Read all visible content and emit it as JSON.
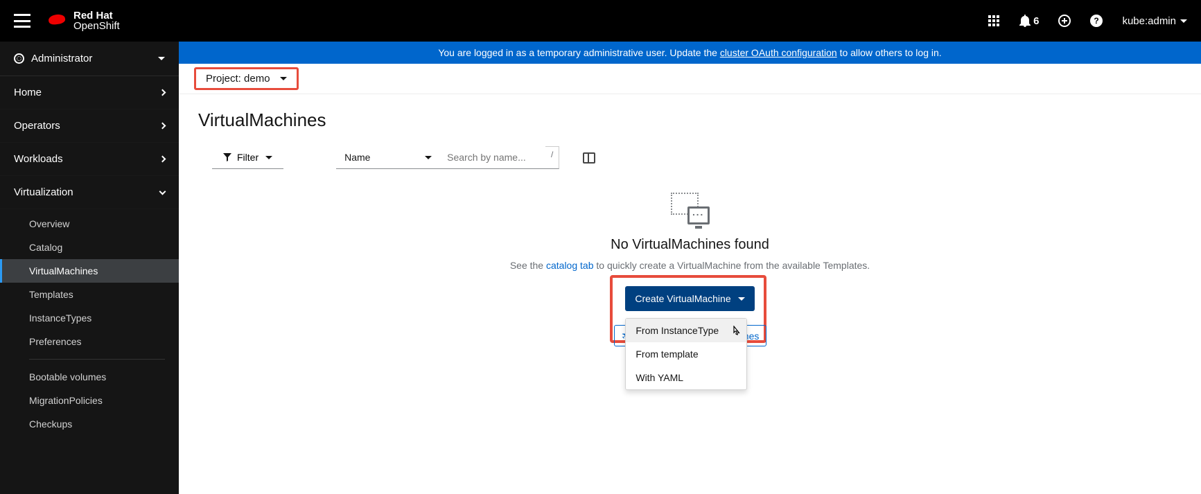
{
  "brand": {
    "line1": "Red Hat",
    "line2": "OpenShift"
  },
  "topbar": {
    "notification_count": "6",
    "username": "kube:admin"
  },
  "perspective": {
    "label": "Administrator"
  },
  "sidebar": {
    "items": [
      {
        "label": "Home"
      },
      {
        "label": "Operators"
      },
      {
        "label": "Workloads"
      },
      {
        "label": "Virtualization"
      }
    ],
    "virt_subitems": [
      "Overview",
      "Catalog",
      "VirtualMachines",
      "Templates",
      "InstanceTypes",
      "Preferences",
      "Bootable volumes",
      "MigrationPolicies",
      "Checkups"
    ]
  },
  "banner": {
    "pre": "You are logged in as a temporary administrative user. Update the ",
    "link": "cluster OAuth configuration",
    "post": " to allow others to log in."
  },
  "project": {
    "prefix": "Project: ",
    "name": "demo"
  },
  "page": {
    "title": "VirtualMachines"
  },
  "toolbar": {
    "filter_label": "Filter",
    "name_label": "Name",
    "search_placeholder": "Search by name...",
    "slash": "/"
  },
  "empty_state": {
    "title": "No VirtualMachines found",
    "sub_pre": "See the ",
    "sub_link": "catalog tab",
    "sub_post": " to quickly create a VirtualMachine from the available Templates.",
    "create_label": "Create VirtualMachine",
    "learn_suffix": "nes",
    "menu": {
      "instancetype": "From InstanceType",
      "template": "From template",
      "yaml": "With YAML"
    }
  }
}
